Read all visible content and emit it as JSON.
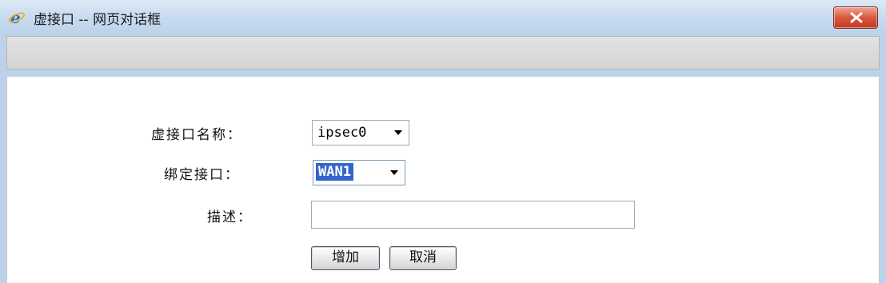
{
  "window": {
    "title": "虚接口 -- 网页对话框",
    "icon": "ie-icon",
    "close_icon": "close-icon"
  },
  "form": {
    "virtual_name": {
      "label": "虚接口名称：",
      "value": "ipsec0"
    },
    "bind_interface": {
      "label": "绑定接口：",
      "value": "WAN1"
    },
    "description": {
      "label": "描述：",
      "value": ""
    }
  },
  "buttons": {
    "add": "增加",
    "cancel": "取消"
  },
  "colors": {
    "titlebar": "#c7dbf0",
    "close": "#d9573e",
    "selection": "#3366cc"
  }
}
